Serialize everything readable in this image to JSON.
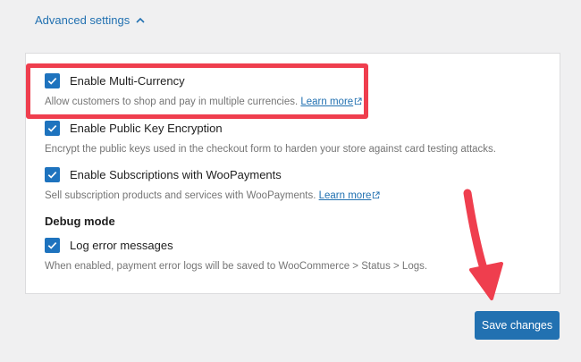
{
  "advanced": {
    "label": "Advanced settings",
    "icon": "chevron-up-icon"
  },
  "options": [
    {
      "label": "Enable Multi-Currency",
      "checked": true,
      "help": "Allow customers to shop and pay in multiple currencies.",
      "link": "Learn more"
    },
    {
      "label": "Enable Public Key Encryption",
      "checked": true,
      "help": "Encrypt the public keys used in the checkout form to harden your store against card testing attacks."
    },
    {
      "label": "Enable Subscriptions with WooPayments",
      "checked": true,
      "help": "Sell subscription products and services with WooPayments.",
      "link": "Learn more"
    }
  ],
  "debug": {
    "heading": "Debug mode",
    "option": {
      "label": "Log error messages",
      "checked": true,
      "help": "When enabled, payment error logs will be saved to WooCommerce > Status > Logs."
    }
  },
  "save_button": {
    "label": "Save changes"
  },
  "colors": {
    "accent": "#2271b1",
    "checkbox": "#1e73be",
    "highlight": "#ef3e4e"
  }
}
